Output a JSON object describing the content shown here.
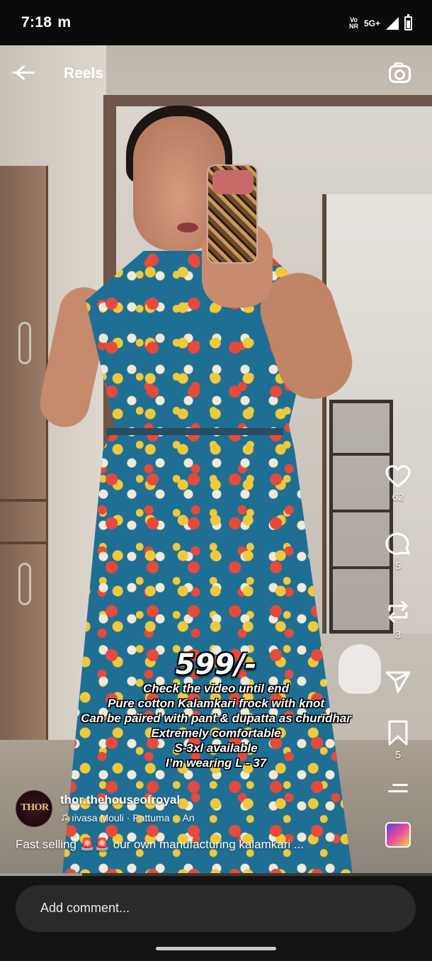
{
  "status_bar": {
    "time": "7:18",
    "carrier_icon": "m",
    "volte_top": "Vo",
    "volte_bottom": "NR",
    "network": "5G+",
    "signal_icon": "signal-icon",
    "battery_icon": "battery-icon"
  },
  "header": {
    "title": "Reels",
    "back_icon": "back-arrow-icon",
    "camera_icon": "camera-icon"
  },
  "video_overlay": {
    "price": "599/-",
    "lines": [
      "Check the video until end",
      "Pure cotton Kalamkari frock with knot",
      "Can be paired with pant & dupatta as churidhar",
      "Extremely comfortable",
      "S-3xl available",
      "I’m wearing L - 37"
    ]
  },
  "actions": {
    "likes": "62",
    "comments": "5",
    "reposts": "3",
    "saves": "5"
  },
  "post": {
    "avatar_text": "THOR",
    "username": "thor.thehouseofroyal",
    "music": "ıivasa Mouli · Pattuma",
    "music_extra": "An",
    "caption": "Fast selling 🚨🚨 our own manufacturing kalamkari ..."
  },
  "progress": {
    "fraction": 0.19
  },
  "comment_bar": {
    "placeholder": "Add comment..."
  },
  "colors": {
    "background": "#000000",
    "bottom_bar": "#141414",
    "comment_box": "#2a2a2a"
  }
}
